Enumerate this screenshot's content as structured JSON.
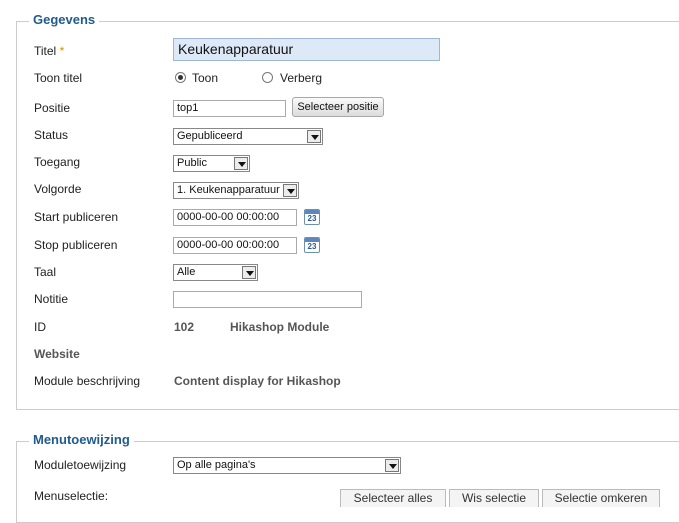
{
  "gegevens": {
    "legend": "Gegevens",
    "titel": {
      "label": "Titel",
      "required_mark": "*",
      "value": "Keukenapparatuur"
    },
    "toon_titel": {
      "label": "Toon titel",
      "option_show": "Toon",
      "option_hide": "Verberg",
      "selected": "Toon"
    },
    "positie": {
      "label": "Positie",
      "value": "top1",
      "button": "Selecteer positie"
    },
    "status": {
      "label": "Status",
      "value": "Gepubliceerd"
    },
    "toegang": {
      "label": "Toegang",
      "value": "Public"
    },
    "volgorde": {
      "label": "Volgorde",
      "value": "1. Keukenapparatuur"
    },
    "start_publiceren": {
      "label": "Start publiceren",
      "value": "0000-00-00 00:00:00",
      "calendar_day": "23"
    },
    "stop_publiceren": {
      "label": "Stop publiceren",
      "value": "0000-00-00 00:00:00",
      "calendar_day": "23"
    },
    "taal": {
      "label": "Taal",
      "value": "Alle"
    },
    "notitie": {
      "label": "Notitie",
      "value": ""
    },
    "id": {
      "label": "ID",
      "value": "102",
      "module_type": "Hikashop Module"
    },
    "website": {
      "label": "Website"
    },
    "module_beschrijving": {
      "label": "Module beschrijving",
      "value": "Content display for Hikashop"
    }
  },
  "menutoewijzing": {
    "legend": "Menutoewijzing",
    "moduletoewijzing": {
      "label": "Moduletoewijzing",
      "value": "Op alle pagina's"
    },
    "menuselectie": {
      "label": "Menuselectie:"
    },
    "buttons": {
      "select_all": "Selecteer alles",
      "clear": "Wis selectie",
      "invert": "Selectie omkeren"
    }
  },
  "colors": {
    "legend": "#1f5b8e",
    "required": "#e58a00",
    "title_input_bg": "#dde9f7"
  },
  "icons": {
    "calendar": "calendar-icon",
    "dropdown": "chevron-down-icon"
  }
}
